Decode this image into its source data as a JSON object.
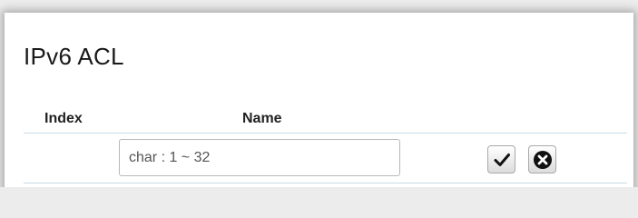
{
  "panel": {
    "title": "IPv6 ACL"
  },
  "table": {
    "columns": [
      "Index",
      "Name"
    ]
  },
  "row": {
    "name_placeholder": "char : 1 ~ 32",
    "name_value": ""
  },
  "icons": {
    "apply": "check-icon",
    "cancel": "circle-x-icon"
  }
}
